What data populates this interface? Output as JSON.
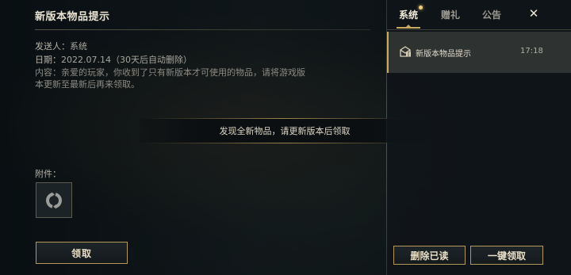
{
  "detail": {
    "title": "新版本物品提示",
    "sender_label": "发送人：",
    "sender_value": "系统",
    "date_label": "日期：",
    "date_value": "2022.07.14（30天后自动删除）",
    "content_label": "内容：",
    "content_text": "亲爱的玩家，你收到了只有新版本才可使用的物品，请将游戏版本更新至最新后再来领取。",
    "attachments_label": "附件：",
    "attachment_icon": "refresh-icon",
    "claim_button": "领取"
  },
  "toast": {
    "message": "发现全新物品，请更新版本后领取"
  },
  "sidebar": {
    "tabs": [
      {
        "label": "系统",
        "active": true,
        "has_dot": true
      },
      {
        "label": "赠礼",
        "active": false
      },
      {
        "label": "公告",
        "active": false
      }
    ],
    "close_label": "✕",
    "mail_items": [
      {
        "icon": "mail-gift-icon",
        "title": "新版本物品提示",
        "time": "17:18",
        "selected": true
      }
    ],
    "delete_read_button": "删除已读",
    "claim_all_button": "一键领取"
  },
  "colors": {
    "accent_gold": "#c9a860",
    "button_border": "#b4975a",
    "notification_dot": "#f0cf7c",
    "panel_bg": "#101519"
  }
}
